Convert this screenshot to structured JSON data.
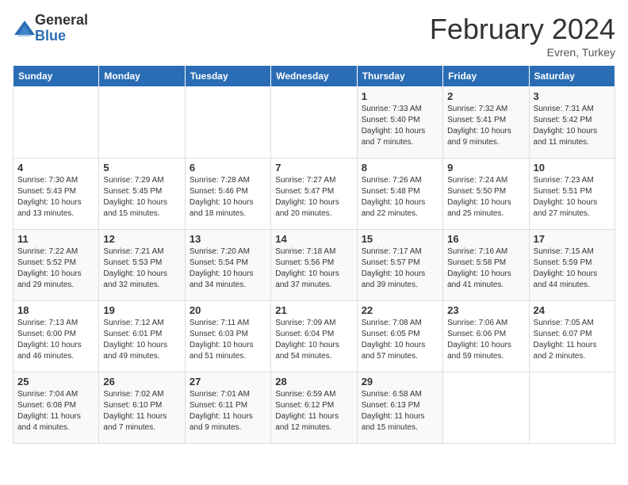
{
  "header": {
    "logo_general": "General",
    "logo_blue": "Blue",
    "month_title": "February 2024",
    "subtitle": "Evren, Turkey"
  },
  "days_of_week": [
    "Sunday",
    "Monday",
    "Tuesday",
    "Wednesday",
    "Thursday",
    "Friday",
    "Saturday"
  ],
  "weeks": [
    [
      {
        "day": "",
        "info": ""
      },
      {
        "day": "",
        "info": ""
      },
      {
        "day": "",
        "info": ""
      },
      {
        "day": "",
        "info": ""
      },
      {
        "day": "1",
        "info": "Sunrise: 7:33 AM\nSunset: 5:40 PM\nDaylight: 10 hours\nand 7 minutes."
      },
      {
        "day": "2",
        "info": "Sunrise: 7:32 AM\nSunset: 5:41 PM\nDaylight: 10 hours\nand 9 minutes."
      },
      {
        "day": "3",
        "info": "Sunrise: 7:31 AM\nSunset: 5:42 PM\nDaylight: 10 hours\nand 11 minutes."
      }
    ],
    [
      {
        "day": "4",
        "info": "Sunrise: 7:30 AM\nSunset: 5:43 PM\nDaylight: 10 hours\nand 13 minutes."
      },
      {
        "day": "5",
        "info": "Sunrise: 7:29 AM\nSunset: 5:45 PM\nDaylight: 10 hours\nand 15 minutes."
      },
      {
        "day": "6",
        "info": "Sunrise: 7:28 AM\nSunset: 5:46 PM\nDaylight: 10 hours\nand 18 minutes."
      },
      {
        "day": "7",
        "info": "Sunrise: 7:27 AM\nSunset: 5:47 PM\nDaylight: 10 hours\nand 20 minutes."
      },
      {
        "day": "8",
        "info": "Sunrise: 7:26 AM\nSunset: 5:48 PM\nDaylight: 10 hours\nand 22 minutes."
      },
      {
        "day": "9",
        "info": "Sunrise: 7:24 AM\nSunset: 5:50 PM\nDaylight: 10 hours\nand 25 minutes."
      },
      {
        "day": "10",
        "info": "Sunrise: 7:23 AM\nSunset: 5:51 PM\nDaylight: 10 hours\nand 27 minutes."
      }
    ],
    [
      {
        "day": "11",
        "info": "Sunrise: 7:22 AM\nSunset: 5:52 PM\nDaylight: 10 hours\nand 29 minutes."
      },
      {
        "day": "12",
        "info": "Sunrise: 7:21 AM\nSunset: 5:53 PM\nDaylight: 10 hours\nand 32 minutes."
      },
      {
        "day": "13",
        "info": "Sunrise: 7:20 AM\nSunset: 5:54 PM\nDaylight: 10 hours\nand 34 minutes."
      },
      {
        "day": "14",
        "info": "Sunrise: 7:18 AM\nSunset: 5:56 PM\nDaylight: 10 hours\nand 37 minutes."
      },
      {
        "day": "15",
        "info": "Sunrise: 7:17 AM\nSunset: 5:57 PM\nDaylight: 10 hours\nand 39 minutes."
      },
      {
        "day": "16",
        "info": "Sunrise: 7:16 AM\nSunset: 5:58 PM\nDaylight: 10 hours\nand 41 minutes."
      },
      {
        "day": "17",
        "info": "Sunrise: 7:15 AM\nSunset: 5:59 PM\nDaylight: 10 hours\nand 44 minutes."
      }
    ],
    [
      {
        "day": "18",
        "info": "Sunrise: 7:13 AM\nSunset: 6:00 PM\nDaylight: 10 hours\nand 46 minutes."
      },
      {
        "day": "19",
        "info": "Sunrise: 7:12 AM\nSunset: 6:01 PM\nDaylight: 10 hours\nand 49 minutes."
      },
      {
        "day": "20",
        "info": "Sunrise: 7:11 AM\nSunset: 6:03 PM\nDaylight: 10 hours\nand 51 minutes."
      },
      {
        "day": "21",
        "info": "Sunrise: 7:09 AM\nSunset: 6:04 PM\nDaylight: 10 hours\nand 54 minutes."
      },
      {
        "day": "22",
        "info": "Sunrise: 7:08 AM\nSunset: 6:05 PM\nDaylight: 10 hours\nand 57 minutes."
      },
      {
        "day": "23",
        "info": "Sunrise: 7:06 AM\nSunset: 6:06 PM\nDaylight: 10 hours\nand 59 minutes."
      },
      {
        "day": "24",
        "info": "Sunrise: 7:05 AM\nSunset: 6:07 PM\nDaylight: 11 hours\nand 2 minutes."
      }
    ],
    [
      {
        "day": "25",
        "info": "Sunrise: 7:04 AM\nSunset: 6:08 PM\nDaylight: 11 hours\nand 4 minutes."
      },
      {
        "day": "26",
        "info": "Sunrise: 7:02 AM\nSunset: 6:10 PM\nDaylight: 11 hours\nand 7 minutes."
      },
      {
        "day": "27",
        "info": "Sunrise: 7:01 AM\nSunset: 6:11 PM\nDaylight: 11 hours\nand 9 minutes."
      },
      {
        "day": "28",
        "info": "Sunrise: 6:59 AM\nSunset: 6:12 PM\nDaylight: 11 hours\nand 12 minutes."
      },
      {
        "day": "29",
        "info": "Sunrise: 6:58 AM\nSunset: 6:13 PM\nDaylight: 11 hours\nand 15 minutes."
      },
      {
        "day": "",
        "info": ""
      },
      {
        "day": "",
        "info": ""
      }
    ]
  ]
}
